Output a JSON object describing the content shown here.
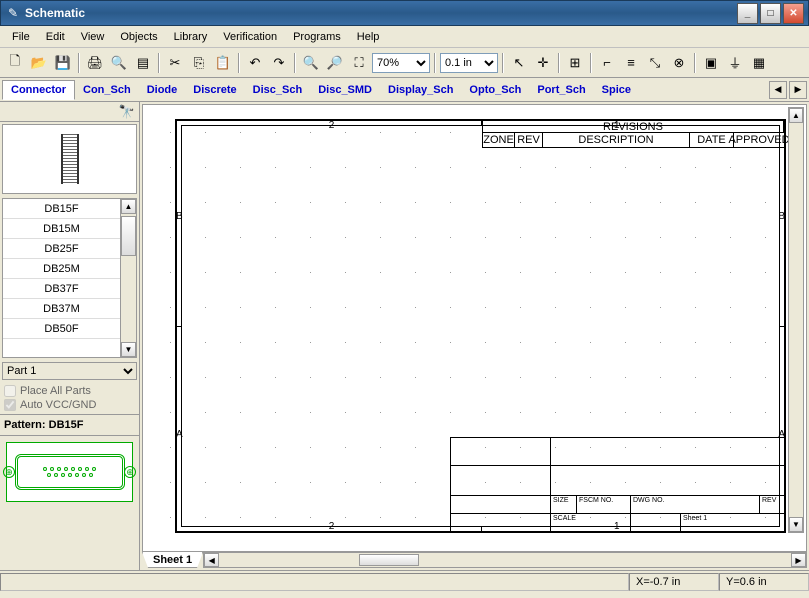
{
  "window": {
    "title": "Schematic"
  },
  "menu": [
    "File",
    "Edit",
    "View",
    "Objects",
    "Library",
    "Verification",
    "Programs",
    "Help"
  ],
  "toolbar": {
    "zoom": "70%",
    "grid": "0.1 in"
  },
  "libtabs": [
    "Connector",
    "Con_Sch",
    "Diode",
    "Discrete",
    "Disc_Sch",
    "Disc_SMD",
    "Display_Sch",
    "Opto_Sch",
    "Port_Sch",
    "Spice"
  ],
  "libtabs_active": 0,
  "parts": [
    "DB15F",
    "DB15M",
    "DB25F",
    "DB25M",
    "DB37F",
    "DB37M",
    "DB50F"
  ],
  "partselect": "Part 1",
  "checks": {
    "place_all": "Place All Parts",
    "auto_vcc": "Auto VCC/GND"
  },
  "pattern_label": "Pattern:",
  "pattern_value": "DB15F",
  "drawing": {
    "cols": [
      "2",
      "1"
    ],
    "rows": [
      "B",
      "A"
    ],
    "revisions": {
      "title": "REVISIONS",
      "headers": [
        "ZONE",
        "REV",
        "DESCRIPTION",
        "DATE",
        "APPROVED"
      ]
    },
    "titleblock": {
      "size": "SIZE",
      "fscm": "FSCM NO.",
      "dwg": "DWG NO.",
      "rev": "REV",
      "scale": "SCALE",
      "sheet": "Sheet 1"
    }
  },
  "sheet_tab": "Sheet 1",
  "status": {
    "x": "X=-0.7 in",
    "y": "Y=0.6 in"
  }
}
